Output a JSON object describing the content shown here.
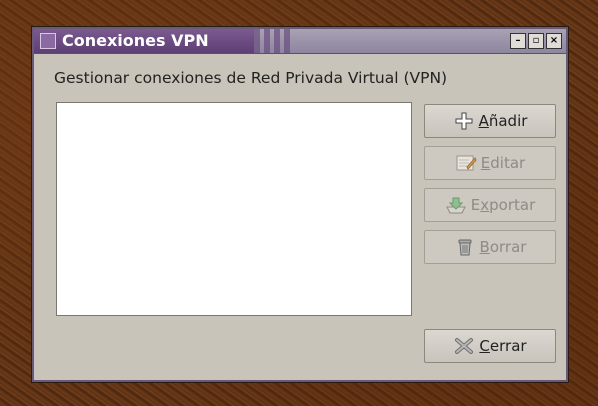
{
  "window": {
    "title": "Conexiones VPN",
    "controls": {
      "minimize": "–",
      "maximize": "▫",
      "close": "×"
    }
  },
  "header": {
    "label": "Gestionar conexiones de Red Privada Virtual (VPN)"
  },
  "buttons": {
    "add": {
      "mnemonic": "A",
      "rest": "ñadir"
    },
    "edit": {
      "mnemonic": "E",
      "rest": "ditar"
    },
    "export": {
      "prefix": "E",
      "mnemonic": "x",
      "rest": "portar"
    },
    "delete": {
      "mnemonic": "B",
      "rest": "orrar"
    },
    "close": {
      "mnemonic": "C",
      "rest": "errar"
    }
  },
  "icons": {
    "add": "plus-icon",
    "edit": "edit-icon",
    "export": "export-icon",
    "delete": "trash-icon",
    "close": "close-icon"
  }
}
